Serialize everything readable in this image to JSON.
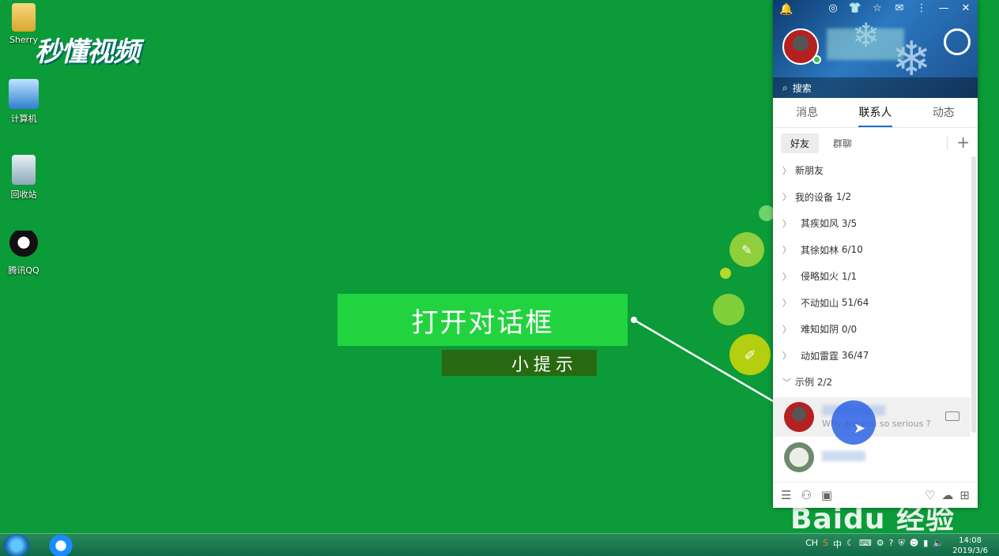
{
  "desktop": {
    "icons": [
      {
        "label": "Sherry",
        "icon": "folder-icon"
      },
      {
        "label": "计算机",
        "icon": "computer-icon"
      },
      {
        "label": "回收站",
        "icon": "recycle-bin-icon"
      },
      {
        "label": "腾讯QQ",
        "icon": "qq-penguin-icon"
      }
    ],
    "watermark": "秒懂视频",
    "baidu_watermark": "Baidu 经验"
  },
  "tip": {
    "main": "打开对话框",
    "sub": "小提示"
  },
  "qq": {
    "search_placeholder": "搜索",
    "tabs": [
      "消息",
      "联系人",
      "动态"
    ],
    "active_tab": "联系人",
    "subtabs": [
      "好友",
      "群聊"
    ],
    "groups": [
      {
        "label": "新朋友",
        "count": ""
      },
      {
        "label": "我的设备",
        "count": "1/2"
      },
      {
        "label": "其疾如风",
        "count": "3/5"
      },
      {
        "label": "其徐如林",
        "count": "6/10"
      },
      {
        "label": "侵略如火",
        "count": "1/1"
      },
      {
        "label": "不动如山",
        "count": "51/64"
      },
      {
        "label": "难知如阴",
        "count": "0/0"
      },
      {
        "label": "动如雷霆",
        "count": "36/47"
      },
      {
        "label": "示例",
        "count": "2/2"
      }
    ],
    "contacts": [
      {
        "status": "Why are you so serious ?"
      }
    ]
  },
  "taskbar": {
    "tray_lang": "CH",
    "tray_ime": "中",
    "time": "14:08",
    "date": "2019/3/6"
  }
}
